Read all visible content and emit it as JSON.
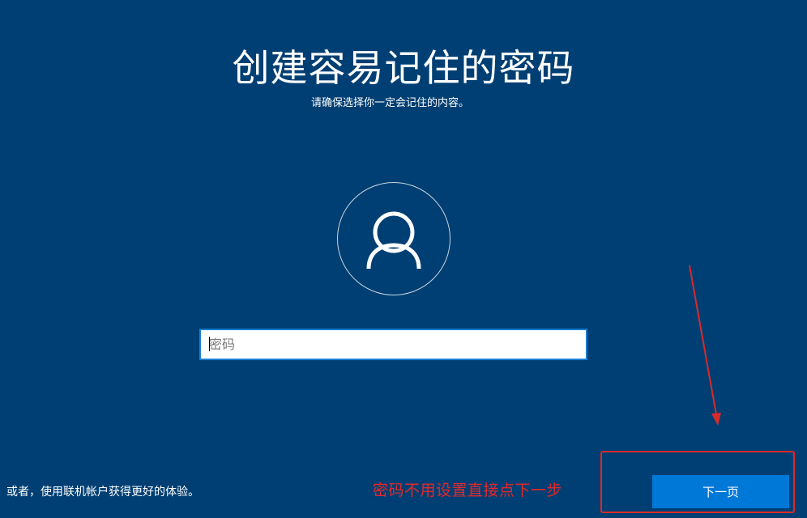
{
  "header": {
    "title": "创建容易记住的密码",
    "subtitle": "请确保选择你一定会记住的内容。"
  },
  "avatar": {
    "icon": "user-icon"
  },
  "password_field": {
    "placeholder": "密码",
    "value": ""
  },
  "footer": {
    "alt_link": "或者，使用联机帐户获得更好的体验。",
    "next_label": "下一页"
  },
  "annotation": {
    "text": "密码不用设置直接点下一步",
    "color": "#e5282a"
  },
  "colors": {
    "background": "#003f73",
    "accent": "#0078d7",
    "annotation_red": "#d92a2a"
  }
}
